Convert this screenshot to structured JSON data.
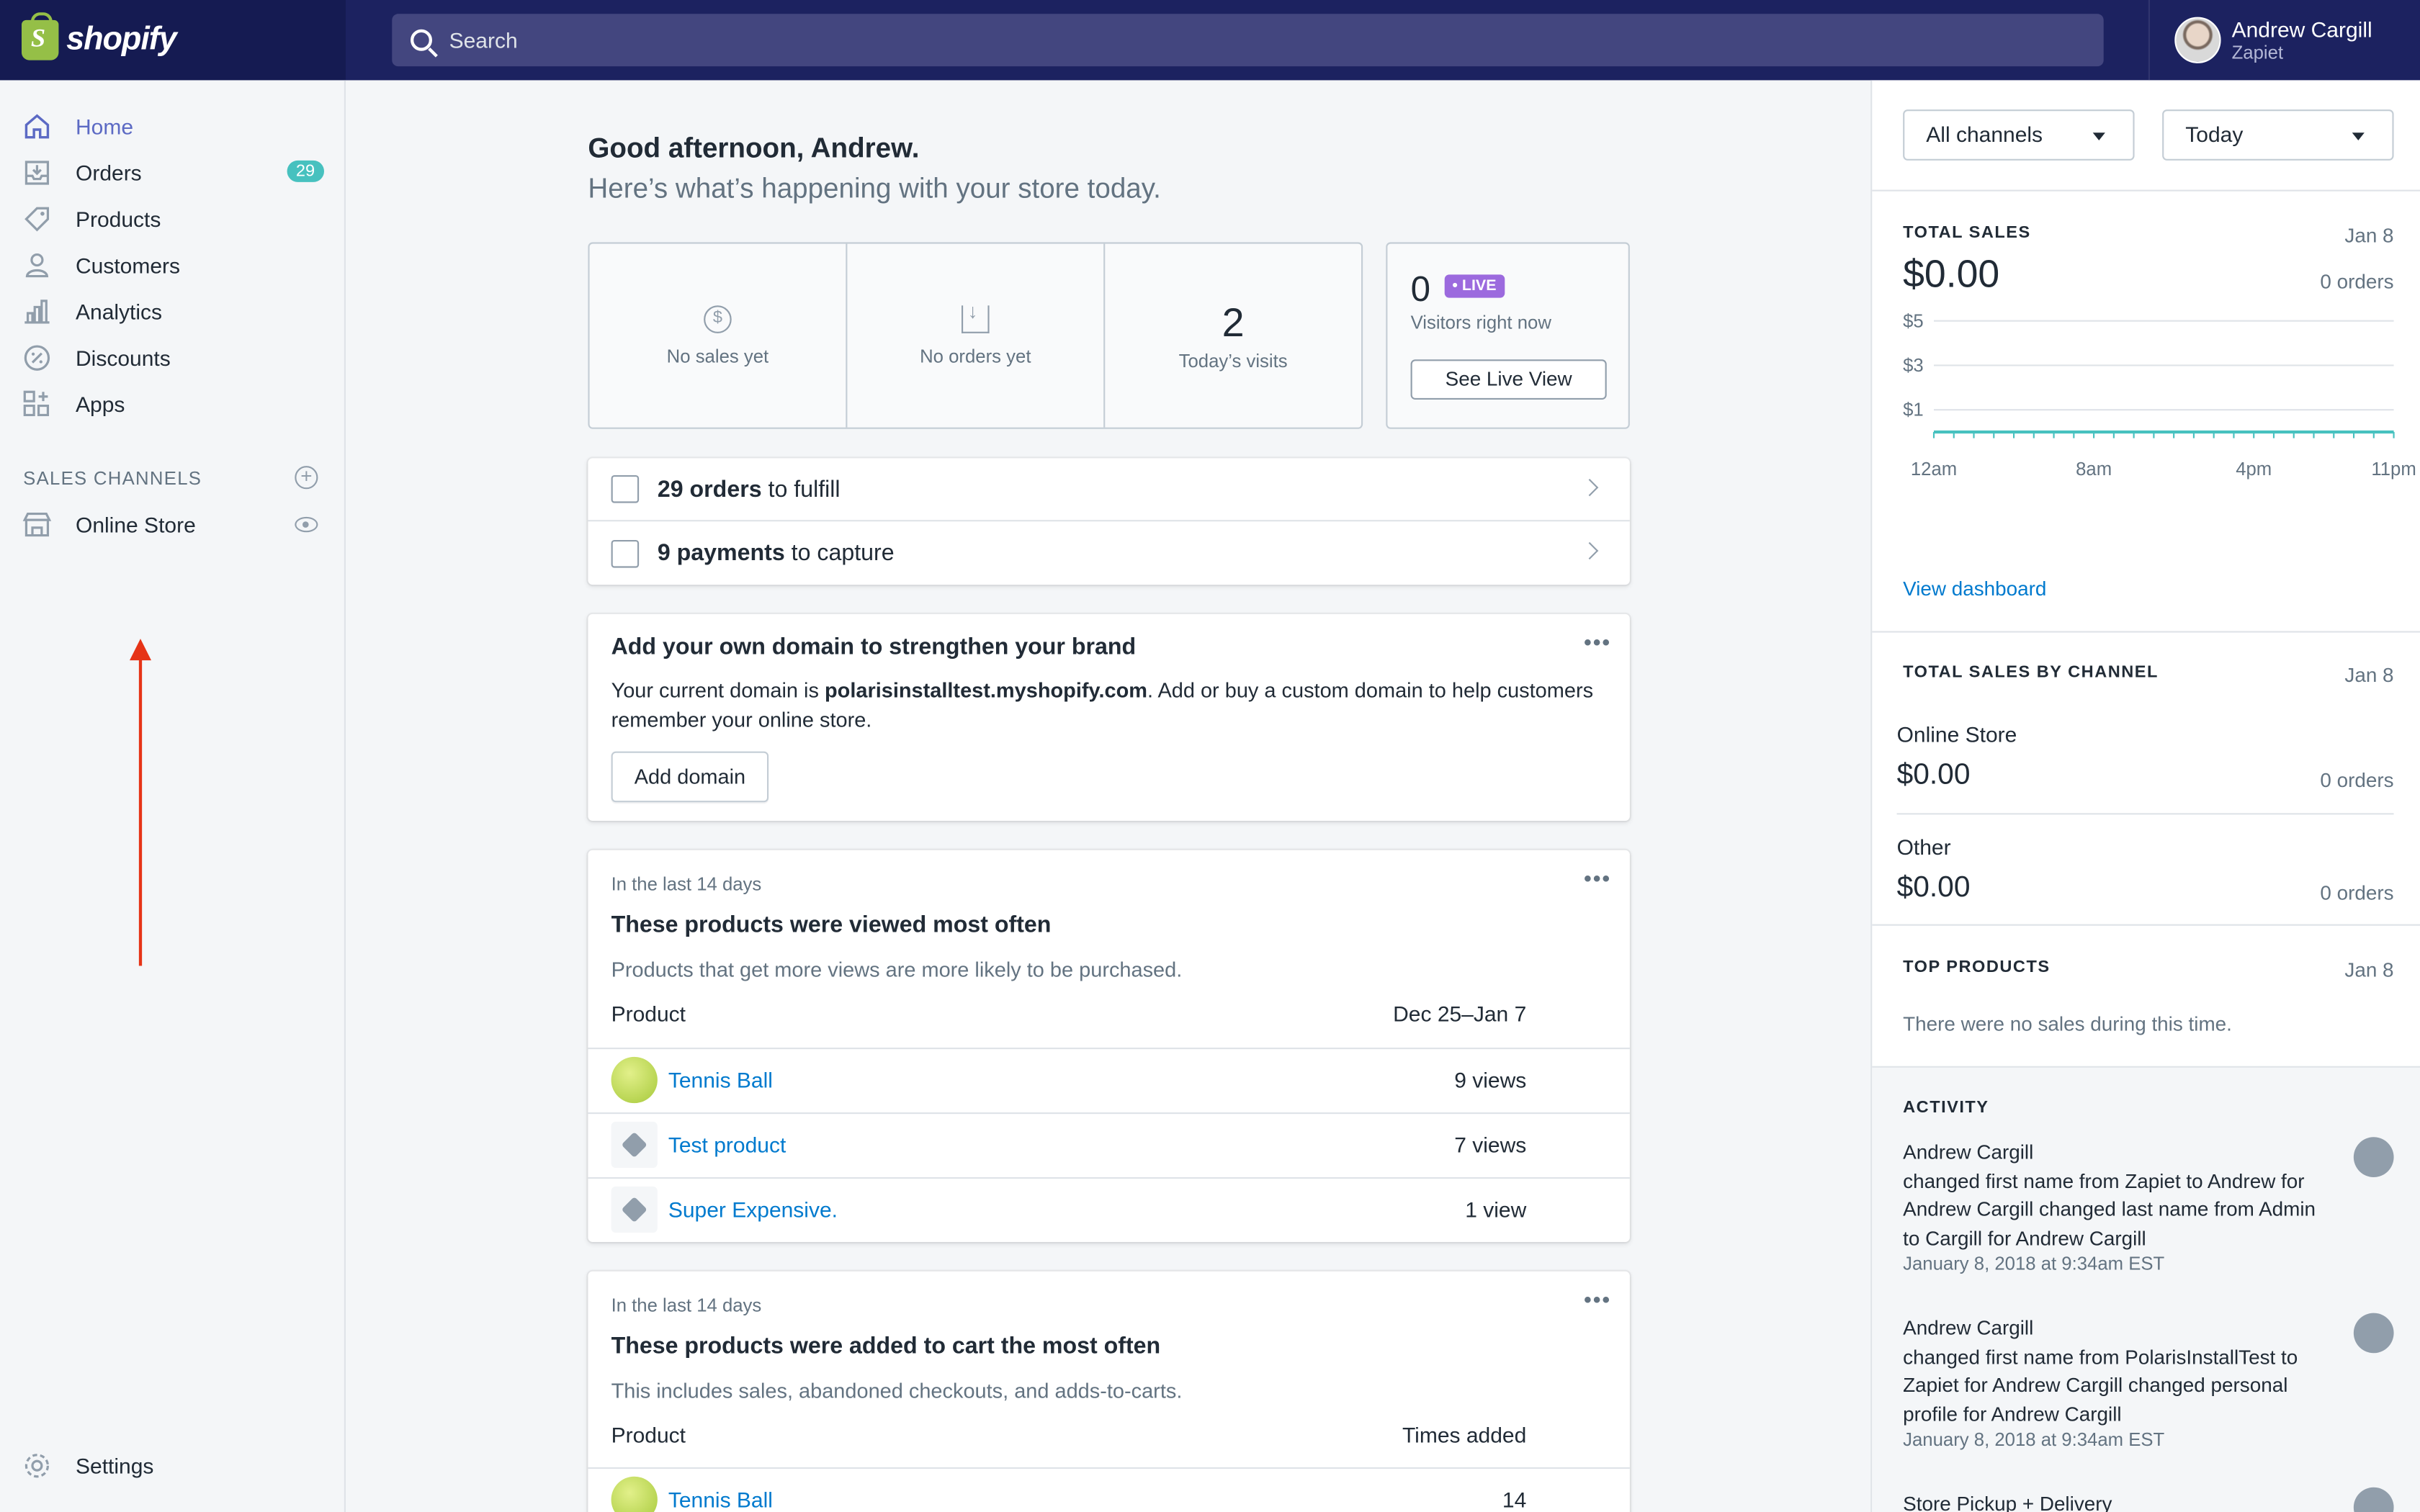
{
  "app": {
    "name": "shopify"
  },
  "search": {
    "placeholder": "Search"
  },
  "user": {
    "name": "Andrew Cargill",
    "store": "Zapiet"
  },
  "sidebar": {
    "items": [
      {
        "label": "Home"
      },
      {
        "label": "Orders",
        "badge": "29"
      },
      {
        "label": "Products"
      },
      {
        "label": "Customers"
      },
      {
        "label": "Analytics"
      },
      {
        "label": "Discounts"
      },
      {
        "label": "Apps"
      }
    ],
    "sales_channels_title": "SALES CHANNELS",
    "online_store": "Online Store",
    "settings": "Settings"
  },
  "colors": {
    "annotation_arrow": "#e63417",
    "accent": "#5c6ac4",
    "link": "#007ace",
    "topbar": "#1c2260"
  },
  "main": {
    "greeting": "Good afternoon, Andrew.",
    "subgreeting": "Here’s what’s happening with your store today.",
    "stats": {
      "sales_label": "No sales yet",
      "orders_label": "No orders yet",
      "visits_value": "2",
      "visits_label": "Today’s visits"
    },
    "live": {
      "count": "0",
      "badge": "• LIVE",
      "sub": "Visitors right now",
      "button": "See Live View"
    },
    "tasks": [
      {
        "bold": "29 orders",
        "rest": " to fulfill"
      },
      {
        "bold": "9 payments",
        "rest": " to capture"
      }
    ],
    "domain": {
      "title": "Add your own domain to strengthen your brand",
      "text_before": "Your current domain is ",
      "domain": "polarisinstalltest.myshopify.com",
      "text_after": ". Add or buy a custom domain to help customers remember your online store.",
      "button": "Add domain"
    },
    "viewed": {
      "kicker": "In the last 14 days",
      "title": "These products were viewed most often",
      "desc": "Products that get more views are more likely to be purchased.",
      "col_product": "Product",
      "col_value": "Dec 25–Jan 7",
      "rows": [
        {
          "name": "Tennis Ball",
          "value": "9 views"
        },
        {
          "name": "Test product",
          "value": "7 views"
        },
        {
          "name": "Super Expensive.",
          "value": "1 view"
        }
      ]
    },
    "cart": {
      "kicker": "In the last 14 days",
      "title": "These products were added to cart the most often",
      "desc": "This includes sales, abandoned checkouts, and adds-to-carts.",
      "col_product": "Product",
      "col_value": "Times added",
      "rows": [
        {
          "name": "Tennis Ball",
          "value": "14"
        }
      ]
    }
  },
  "right": {
    "channel_select": "All channels",
    "date_select": "Today",
    "total_sales": {
      "title": "TOTAL SALES",
      "date": "Jan 8",
      "value": "$0.00",
      "orders": "0 orders"
    },
    "chart_data": {
      "type": "line",
      "x_ticks": [
        "12am",
        "8am",
        "4pm",
        "11pm"
      ],
      "y_ticks": [
        "$5",
        "$3",
        "$1"
      ],
      "values": [
        0,
        0,
        0,
        0,
        0,
        0,
        0,
        0,
        0,
        0,
        0,
        0,
        0,
        0,
        0,
        0,
        0,
        0,
        0,
        0,
        0,
        0,
        0,
        0
      ],
      "ylim": [
        0,
        5
      ]
    },
    "view_dashboard": "View dashboard",
    "by_channel": {
      "title": "TOTAL SALES BY CHANNEL",
      "date": "Jan 8",
      "rows": [
        {
          "name": "Online Store",
          "value": "$0.00",
          "orders": "0 orders"
        },
        {
          "name": "Other",
          "value": "$0.00",
          "orders": "0 orders"
        }
      ]
    },
    "top_products": {
      "title": "TOP PRODUCTS",
      "date": "Jan 8",
      "empty": "There were no sales during this time."
    },
    "activity": {
      "title": "ACTIVITY",
      "items": [
        {
          "name": "Andrew Cargill",
          "text": "changed first name from Zapiet to Andrew for Andrew Cargill changed last name from Admin to Cargill for Andrew Cargill",
          "date": "January 8, 2018 at 9:34am EST"
        },
        {
          "name": "Andrew Cargill",
          "text": "changed first name from PolarisInstallTest to Zapiet for Andrew Cargill changed personal profile for Andrew Cargill",
          "date": "January 8, 2018 at 9:34am EST"
        },
        {
          "name": "Store Pickup + Delivery"
        }
      ]
    }
  }
}
